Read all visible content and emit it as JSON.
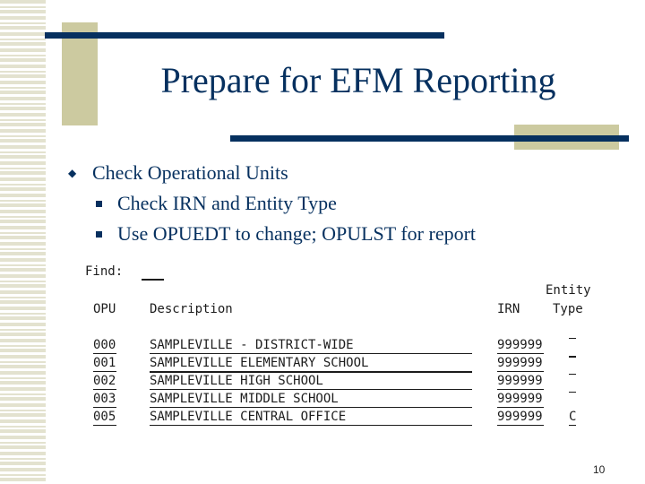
{
  "slide": {
    "title": "Prepare for EFM Reporting",
    "page_number": "10",
    "colors": {
      "navy": "#06305f",
      "khaki": "#cccaa0",
      "stripe": "#e3e2cf"
    }
  },
  "bullets": {
    "level1": {
      "icon": "diamond-bullet-icon",
      "text": "Check Operational Units"
    },
    "level2": [
      {
        "icon": "square-bullet-icon",
        "text": "Check IRN and Entity Type"
      },
      {
        "icon": "square-bullet-icon",
        "text": "Use OPUEDT to change; OPULST for report"
      }
    ]
  },
  "screen": {
    "find_label": "Find:",
    "find_value": "",
    "headers": {
      "opu": "OPU",
      "description": "Description",
      "irn": "IRN",
      "entity_type_line1": "Entity",
      "entity_type_line2": "Type"
    },
    "rows": [
      {
        "opu": "000",
        "description": "SAMPLEVILLE - DISTRICT-WIDE",
        "irn": "999999",
        "entity_type": ""
      },
      {
        "opu": "001",
        "description": "SAMPLEVILLE ELEMENTARY SCHOOL",
        "irn": "999999",
        "entity_type": ""
      },
      {
        "opu": "002",
        "description": "SAMPLEVILLE HIGH SCHOOL",
        "irn": "999999",
        "entity_type": ""
      },
      {
        "opu": "003",
        "description": "SAMPLEVILLE MIDDLE SCHOOL",
        "irn": "999999",
        "entity_type": ""
      },
      {
        "opu": "005",
        "description": "SAMPLEVILLE CENTRAL OFFICE",
        "irn": "999999",
        "entity_type": "C"
      }
    ]
  }
}
